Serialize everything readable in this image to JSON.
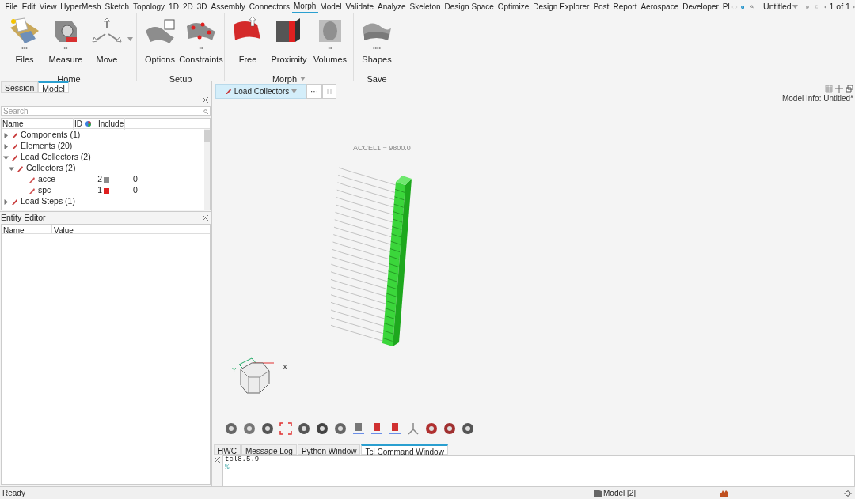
{
  "menu": [
    {
      "label": "File",
      "selected": false
    },
    {
      "label": "Edit",
      "selected": false
    },
    {
      "label": "View",
      "selected": false
    },
    {
      "label": "HyperMesh",
      "selected": false
    },
    {
      "label": "Sketch",
      "selected": false
    },
    {
      "label": "Topology",
      "selected": false
    },
    {
      "label": "1D",
      "selected": false
    },
    {
      "label": "2D",
      "selected": false
    },
    {
      "label": "3D",
      "selected": false
    },
    {
      "label": "Assembly",
      "selected": false
    },
    {
      "label": "Connectors",
      "selected": false
    },
    {
      "label": "Morph",
      "selected": true
    },
    {
      "label": "Model",
      "selected": false
    },
    {
      "label": "Validate",
      "selected": false
    },
    {
      "label": "Analyze",
      "selected": false
    },
    {
      "label": "Skeleton",
      "selected": false
    },
    {
      "label": "Design Space",
      "selected": false
    },
    {
      "label": "Optimize",
      "selected": false
    },
    {
      "label": "Design Explorer",
      "selected": false
    },
    {
      "label": "Post",
      "selected": false
    },
    {
      "label": "Report",
      "selected": false
    },
    {
      "label": "Aerospace",
      "selected": false
    },
    {
      "label": "Developer",
      "selected": false
    },
    {
      "label": "Pl",
      "selected": false
    }
  ],
  "document": {
    "title": "Untitled",
    "pager": "1 of 1"
  },
  "ribbon": [
    {
      "label": "Home",
      "tools": [
        {
          "label": "Files",
          "dots": "•••"
        },
        {
          "label": "Measure",
          "dots": "••"
        },
        {
          "label": "Move",
          "has_menu": true
        }
      ]
    },
    {
      "label": "Setup",
      "tools": [
        {
          "label": "Options"
        },
        {
          "label": "Constraints",
          "dots": "••"
        }
      ]
    },
    {
      "label": "Morph",
      "has_menu": true,
      "tools": [
        {
          "label": "Free"
        },
        {
          "label": "Proximity"
        },
        {
          "label": "Volumes",
          "dots": "••"
        }
      ]
    },
    {
      "label": "Save",
      "tools": [
        {
          "label": "Shapes",
          "dots": "••••"
        }
      ]
    }
  ],
  "left_panel": {
    "tabs": [
      {
        "label": "Session",
        "selected": false
      },
      {
        "label": "Model",
        "selected": true
      }
    ],
    "search": {
      "placeholder": "Search"
    },
    "columns": [
      "Name",
      "ID",
      "Include"
    ],
    "tree": [
      {
        "label": "Components (1)",
        "expanded": false
      },
      {
        "label": "Elements (20)",
        "expanded": false
      },
      {
        "label": "Load Collectors (2)",
        "expanded": true,
        "children": [
          {
            "label": "Collectors (2)",
            "expanded": true,
            "children": [
              {
                "label": "acce",
                "id": "2",
                "color": "#8c8c8c",
                "include": "0"
              },
              {
                "label": "spc",
                "id": "1",
                "color": "#e02020",
                "include": "0"
              }
            ]
          }
        ]
      },
      {
        "label": "Load Steps (1)",
        "expanded": false
      }
    ]
  },
  "entity_editor": {
    "title": "Entity Editor",
    "columns": [
      "Name",
      "Value"
    ]
  },
  "viewport": {
    "collector_button": "Load Collectors",
    "more_button": "···",
    "model_info": "Model Info: Untitled*",
    "load_label": "ACCEL1 = 9800.0",
    "axis_x": "X",
    "axis_y": "Y"
  },
  "console": {
    "tabs": [
      {
        "label": "HWC",
        "selected": false
      },
      {
        "label": "Message Log",
        "selected": false
      },
      {
        "label": "Python Window",
        "selected": false
      },
      {
        "label": "Tcl Command Window",
        "selected": true
      }
    ],
    "lines": [
      "tcl8.5.9",
      "%"
    ]
  },
  "status_bar": {
    "state": "Ready",
    "model": "Model [2]"
  }
}
